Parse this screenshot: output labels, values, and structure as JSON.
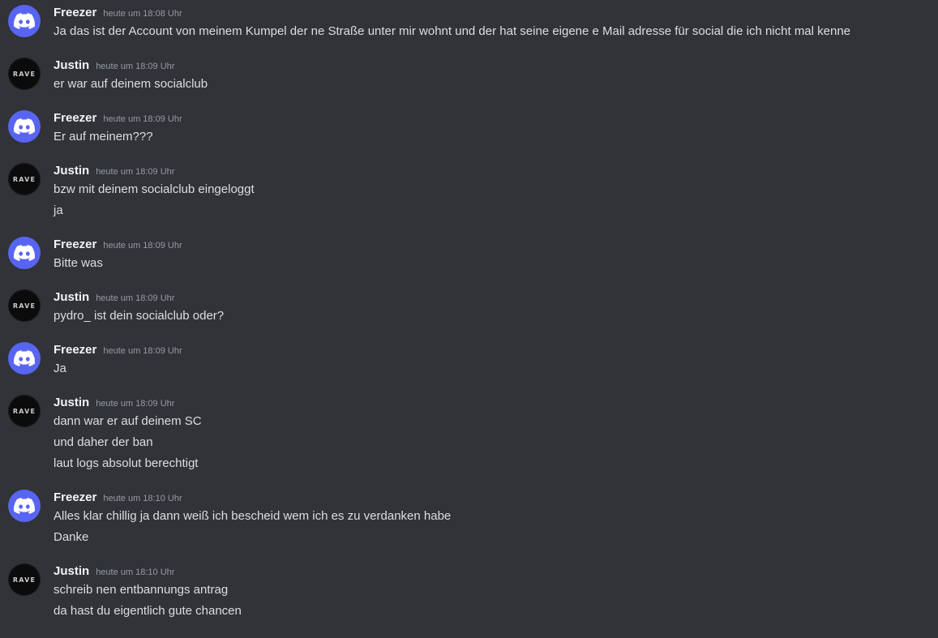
{
  "messages": [
    {
      "author": "Freezer",
      "avatar": "discord-logo-icon",
      "timestamp": "heute um 18:08 Uhr",
      "lines": [
        "Ja das ist der Account von meinem Kumpel der ne Straße unter mir wohnt und der hat seine eigene e Mail adresse für social die ich nicht mal kenne"
      ]
    },
    {
      "author": "Justin",
      "avatar": "rave-avatar",
      "avatar_text": "RAVE",
      "timestamp": "heute um 18:09 Uhr",
      "lines": [
        "er war auf deinem socialclub"
      ]
    },
    {
      "author": "Freezer",
      "avatar": "discord-logo-icon",
      "timestamp": "heute um 18:09 Uhr",
      "lines": [
        "Er auf meinem???"
      ]
    },
    {
      "author": "Justin",
      "avatar": "rave-avatar",
      "avatar_text": "RAVE",
      "timestamp": "heute um 18:09 Uhr",
      "lines": [
        "bzw mit deinem socialclub eingeloggt",
        "ja"
      ]
    },
    {
      "author": "Freezer",
      "avatar": "discord-logo-icon",
      "timestamp": "heute um 18:09 Uhr",
      "lines": [
        "Bitte was"
      ]
    },
    {
      "author": "Justin",
      "avatar": "rave-avatar",
      "avatar_text": "RAVE",
      "timestamp": "heute um 18:09 Uhr",
      "lines": [
        "pydro_ ist dein socialclub oder?"
      ]
    },
    {
      "author": "Freezer",
      "avatar": "discord-logo-icon",
      "timestamp": "heute um 18:09 Uhr",
      "lines": [
        "Ja"
      ]
    },
    {
      "author": "Justin",
      "avatar": "rave-avatar",
      "avatar_text": "RAVE",
      "timestamp": "heute um 18:09 Uhr",
      "lines": [
        "dann war er auf deinem SC",
        "und daher der ban",
        "laut logs absolut berechtigt"
      ]
    },
    {
      "author": "Freezer",
      "avatar": "discord-logo-icon",
      "timestamp": "heute um 18:10 Uhr",
      "lines": [
        "Alles klar chillig ja dann weiß ich bescheid wem ich es zu verdanken habe",
        "Danke"
      ]
    },
    {
      "author": "Justin",
      "avatar": "rave-avatar",
      "avatar_text": "RAVE",
      "timestamp": "heute um 18:10 Uhr",
      "lines": [
        "schreib nen entbannungs antrag",
        "da hast du eigentlich gute chancen"
      ]
    }
  ],
  "colors": {
    "background": "#313338",
    "discord_blurple": "#5865f2",
    "username": "#f2f3f5",
    "timestamp": "#949ba4",
    "message_text": "#dbdee1"
  }
}
